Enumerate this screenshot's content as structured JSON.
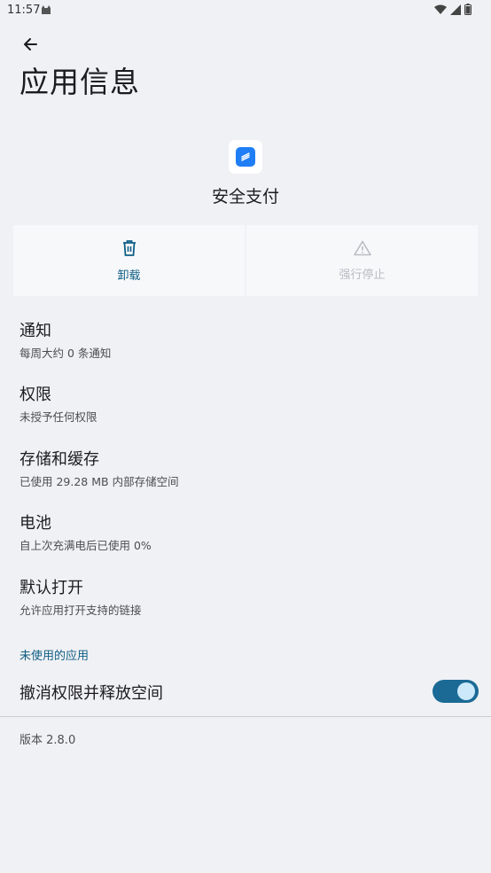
{
  "status_bar": {
    "time": "11:57"
  },
  "header": {
    "title": "应用信息"
  },
  "app": {
    "name": "安全支付"
  },
  "actions": {
    "uninstall": "卸载",
    "force_stop": "强行停止"
  },
  "items": [
    {
      "title": "通知",
      "sub": "每周大约 0 条通知"
    },
    {
      "title": "权限",
      "sub": "未授予任何权限"
    },
    {
      "title": "存储和缓存",
      "sub": "已使用 29.28 MB 内部存储空间"
    },
    {
      "title": "电池",
      "sub": "自上次充满电后已使用 0%"
    },
    {
      "title": "默认打开",
      "sub": "允许应用打开支持的链接"
    }
  ],
  "unused_apps": {
    "header": "未使用的应用",
    "revoke_label": "撤消权限并释放空间",
    "revoke_enabled": true
  },
  "footer": {
    "version": "版本 2.8.0"
  },
  "colors": {
    "accent": "#0f5e85",
    "toggle_on": "#1a6a95",
    "app_icon": "#1f7ef5"
  }
}
